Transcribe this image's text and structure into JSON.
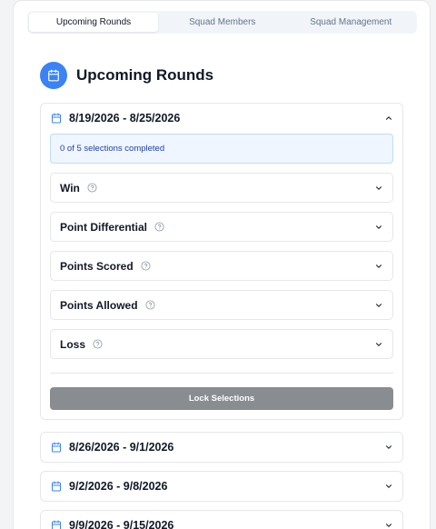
{
  "tabs": [
    {
      "label": "Upcoming Rounds",
      "active": true
    },
    {
      "label": "Squad Members",
      "active": false
    },
    {
      "label": "Squad Management",
      "active": false
    }
  ],
  "header": {
    "title": "Upcoming Rounds",
    "icon": "calendar-icon",
    "accent": "#3b82f6"
  },
  "rounds": [
    {
      "date": "8/19/2026 - 8/25/2026",
      "expanded": true,
      "progress": "0 of 5 selections completed",
      "selections": [
        {
          "label": "Win"
        },
        {
          "label": "Point Differential"
        },
        {
          "label": "Points Scored"
        },
        {
          "label": "Points Allowed"
        },
        {
          "label": "Loss"
        }
      ],
      "lock_label": "Lock Selections"
    },
    {
      "date": "8/26/2026 - 9/1/2026",
      "expanded": false
    },
    {
      "date": "9/2/2026 - 9/8/2026",
      "expanded": false
    },
    {
      "date": "9/9/2026 - 9/15/2026",
      "expanded": false
    }
  ]
}
